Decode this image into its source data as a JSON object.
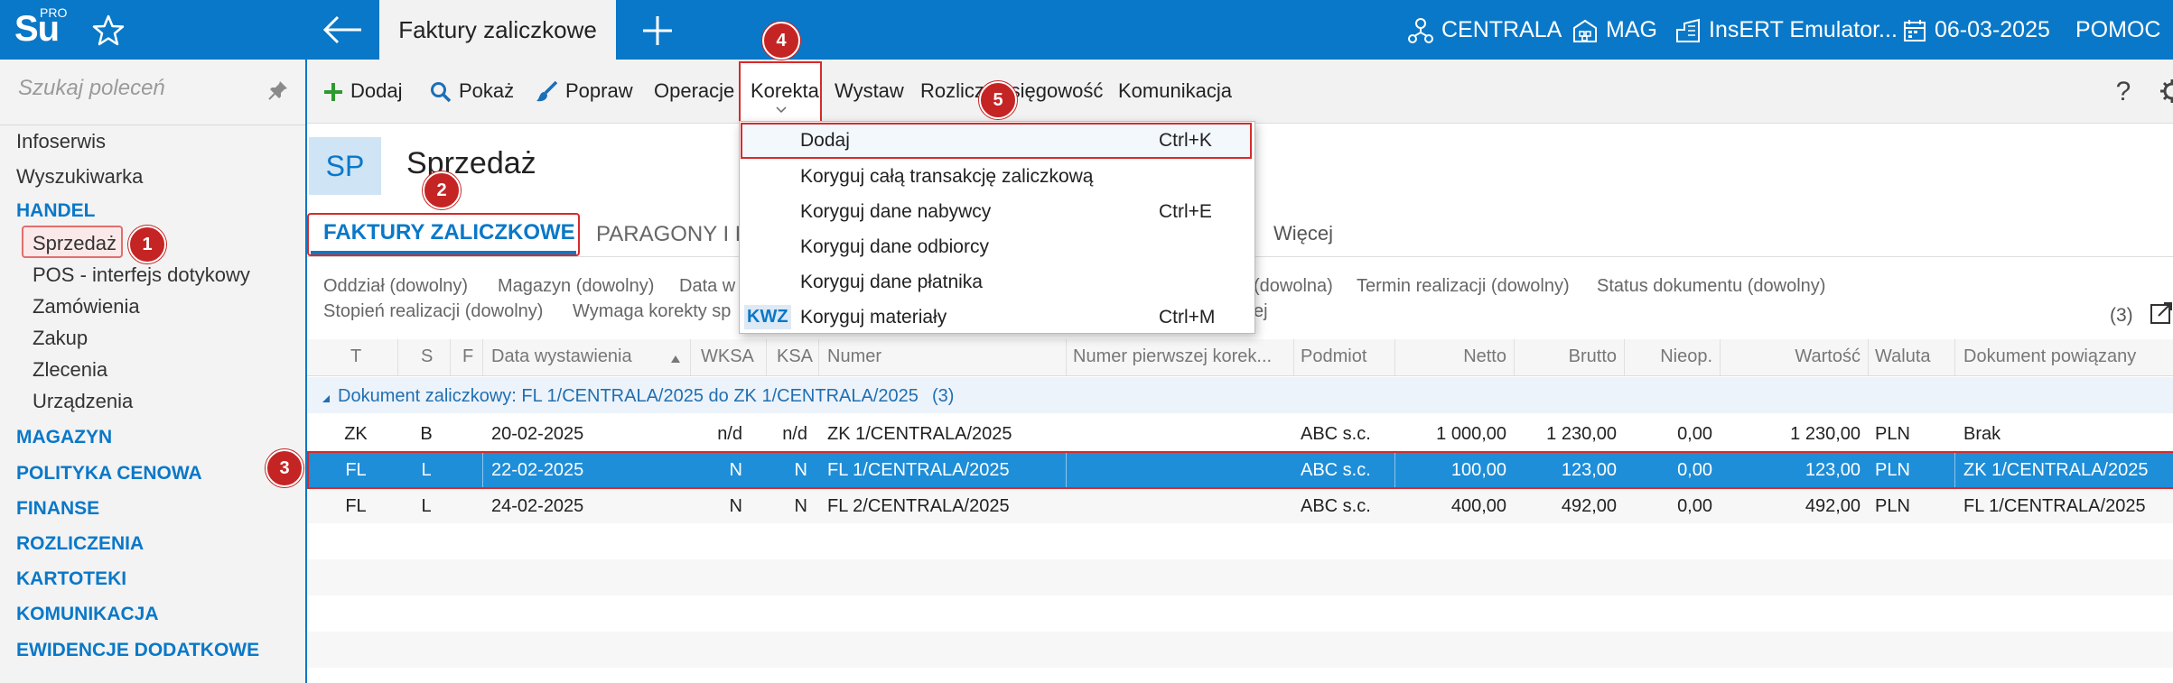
{
  "app": {
    "logo": "Su",
    "logo_sup": "PRO",
    "active_tab": "Faktury zaliczkowe",
    "top_right": {
      "branch": "CENTRALA",
      "warehouse": "MAG",
      "company": "InsERT Emulator...",
      "date": "06-03-2025",
      "help": "POMOC"
    }
  },
  "sidebar": {
    "search_placeholder": "Szukaj poleceń",
    "items": [
      {
        "label": "Infoserwis"
      },
      {
        "label": "Wyszukiwarka"
      },
      {
        "label": "HANDEL"
      },
      {
        "label": "Sprzedaż"
      },
      {
        "label": "POS - interfejs dotykowy"
      },
      {
        "label": "Zamówienia"
      },
      {
        "label": "Zakup"
      },
      {
        "label": "Zlecenia"
      },
      {
        "label": "Urządzenia"
      },
      {
        "label": "MAGAZYN"
      },
      {
        "label": "POLITYKA CENOWA"
      },
      {
        "label": "FINANSE"
      },
      {
        "label": "ROZLICZENIA"
      },
      {
        "label": "KARTOTEKI"
      },
      {
        "label": "KOMUNIKACJA"
      },
      {
        "label": "EWIDENCJE DODATKOWE"
      }
    ]
  },
  "toolbar": {
    "dodaj": "Dodaj",
    "pokaz": "Pokaż",
    "popraw": "Popraw",
    "operacje": "Operacje",
    "korekta": "Korekta",
    "wystaw": "Wystaw",
    "rozlicz": "Rozlicz",
    "ksiegowosc": "Księgowość",
    "komunikacja": "Komunikacja"
  },
  "header": {
    "badge": "SP",
    "title": "Sprzedaż"
  },
  "tabs": {
    "faktury": "FAKTURY ZALICZKOWE",
    "paragony": "PARAGONY I F",
    "wiecej": "Więcej"
  },
  "filters": {
    "oddzial": "Oddział (dowolny)",
    "magazyn": "Magazyn (dowolny)",
    "data": "Data w",
    "dowolna": "(dowolna)",
    "termin": "Termin realizacji (dowolny)",
    "status": "Status dokumentu (dowolny)",
    "stopien": "Stopień realizacji (dowolny)",
    "wymaga": "Wymaga korekty sp",
    "ej": "ej",
    "count": "(3)"
  },
  "grid": {
    "headers": {
      "t": "T",
      "s": "S",
      "f": "F",
      "data": "Data wystawienia",
      "wksa": "WKSA",
      "ksa": "KSA",
      "numer": "Numer",
      "numer_pierwszej": "Numer pierwszej korek...",
      "podmiot": "Podmiot",
      "netto": "Netto",
      "brutto": "Brutto",
      "nieop": "Nieop.",
      "wartosc": "Wartość",
      "waluta": "Waluta",
      "dokument": "Dokument powiązany"
    },
    "group_label": "Dokument zaliczkowy: FL 1/CENTRALA/2025 do ZK 1/CENTRALA/2025",
    "group_count": "(3)",
    "rows": [
      {
        "t": "ZK",
        "s": "B",
        "data": "20-02-2025",
        "wksa": "n/d",
        "ksa": "n/d",
        "numer": "ZK 1/CENTRALA/2025",
        "podmiot": "ABC s.c.",
        "netto": "1 000,00",
        "brutto": "1 230,00",
        "nieop": "0,00",
        "wartosc": "1 230,00",
        "waluta": "PLN",
        "dokument": "Brak"
      },
      {
        "t": "FL",
        "s": "L",
        "data": "22-02-2025",
        "wksa": "N",
        "ksa": "N",
        "numer": "FL 1/CENTRALA/2025",
        "podmiot": "ABC s.c.",
        "netto": "100,00",
        "brutto": "123,00",
        "nieop": "0,00",
        "wartosc": "123,00",
        "waluta": "PLN",
        "dokument": "ZK 1/CENTRALA/2025"
      },
      {
        "t": "FL",
        "s": "L",
        "data": "24-02-2025",
        "wksa": "N",
        "ksa": "N",
        "numer": "FL 2/CENTRALA/2025",
        "podmiot": "ABC s.c.",
        "netto": "400,00",
        "brutto": "492,00",
        "nieop": "0,00",
        "wartosc": "492,00",
        "waluta": "PLN",
        "dokument": "FL 1/CENTRALA/2025"
      }
    ]
  },
  "dropdown": {
    "items": [
      {
        "label": "Dodaj",
        "shortcut": "Ctrl+K"
      },
      {
        "label": "Koryguj całą transakcję zaliczkową",
        "shortcut": ""
      },
      {
        "label": "Koryguj dane nabywcy",
        "shortcut": "Ctrl+E"
      },
      {
        "label": "Koryguj dane odbiorcy",
        "shortcut": ""
      },
      {
        "label": "Koryguj dane płatnika",
        "shortcut": ""
      },
      {
        "label": "Koryguj materiały",
        "shortcut": "Ctrl+M"
      }
    ],
    "kwz": "KWZ"
  },
  "badges": [
    "1",
    "2",
    "3",
    "4",
    "5"
  ],
  "colors": {
    "accent": "#0a78c8",
    "selection": "#1e8ed8",
    "highlight": "#d82a2a"
  }
}
